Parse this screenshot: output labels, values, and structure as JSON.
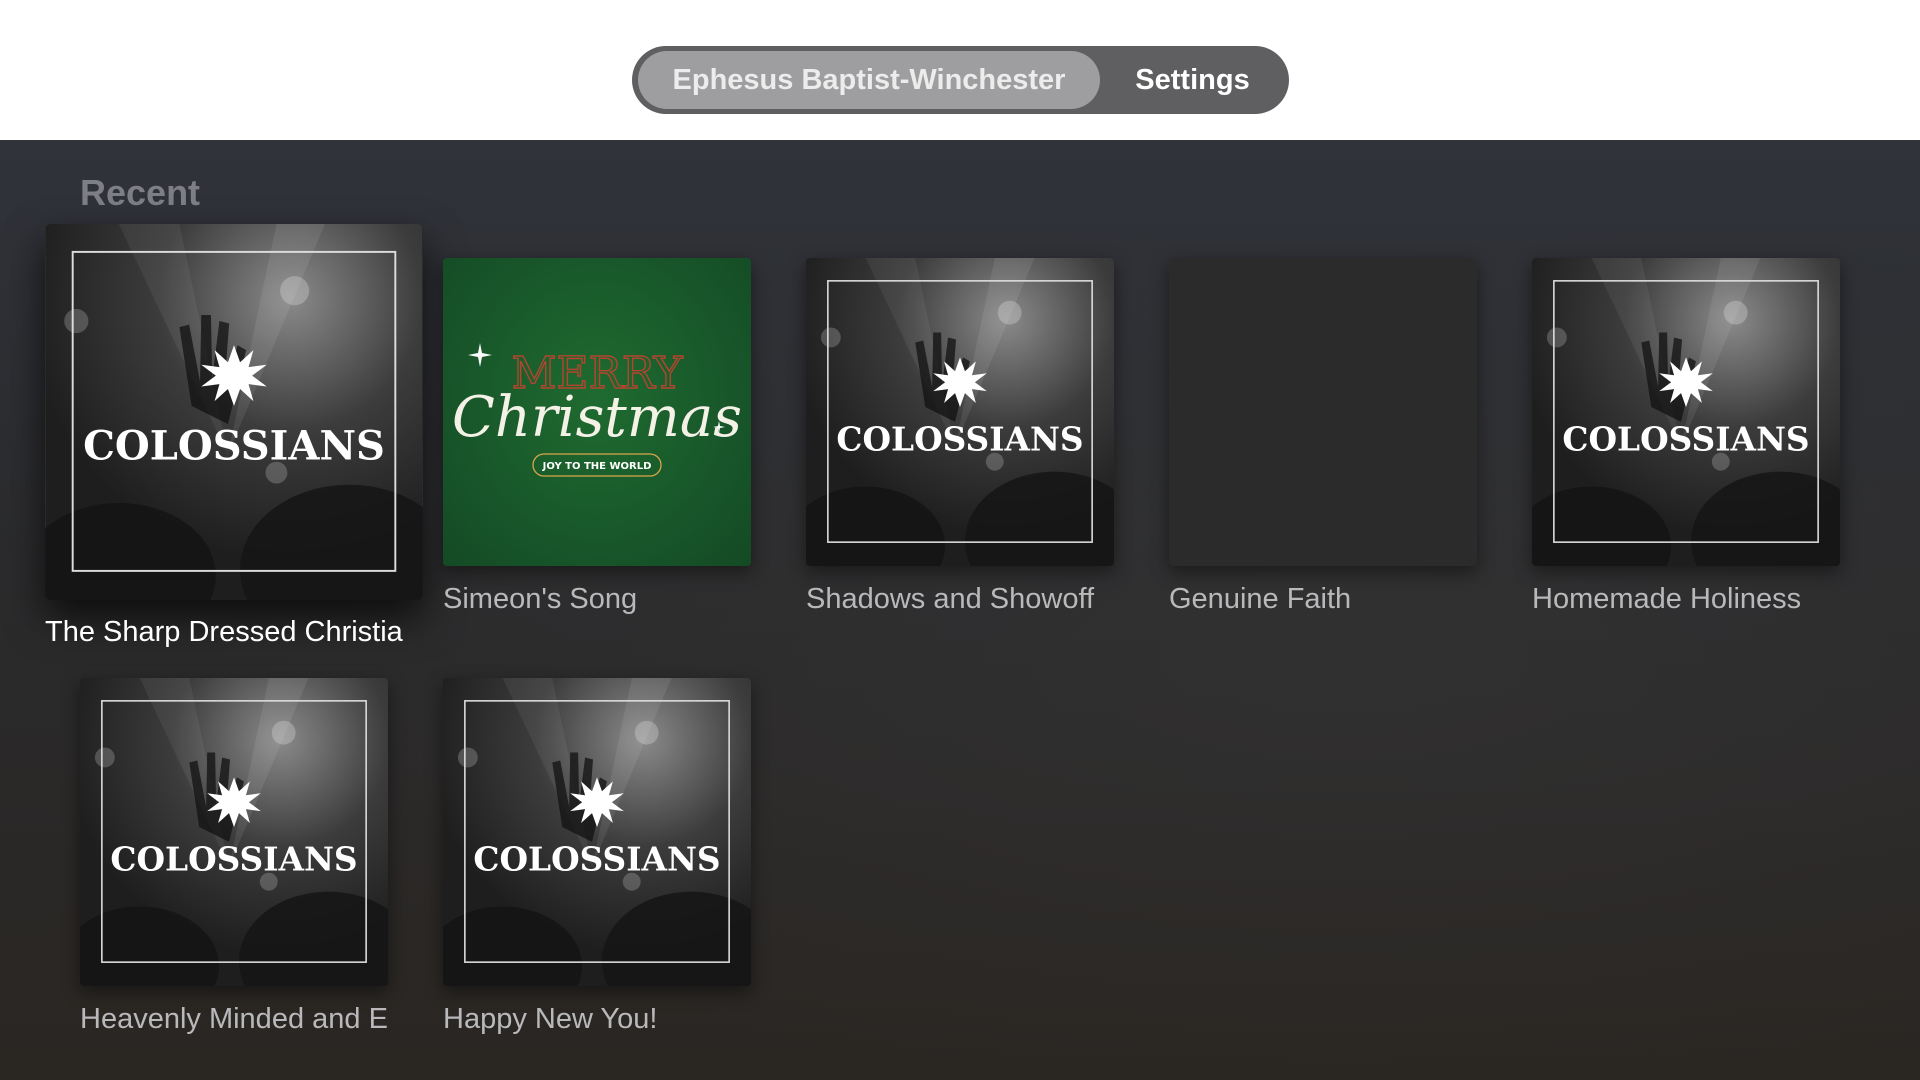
{
  "tabs": {
    "church_label": "Ephesus Baptist-Winchester",
    "settings_label": "Settings"
  },
  "section": {
    "title": "Recent"
  },
  "artwork_text": {
    "colossians": "COLOSSIANS",
    "merry": "MERRY",
    "christmas": "Christmas",
    "joy": "JOY TO THE WORLD"
  },
  "tiles": [
    {
      "label": "The Sharp Dressed Christia",
      "art": "colossians",
      "focused": true
    },
    {
      "label": "Simeon's Song",
      "art": "christmas"
    },
    {
      "label": "Shadows and Showoff",
      "art": "colossians"
    },
    {
      "label": "Genuine Faith",
      "art": "empty"
    },
    {
      "label": "Homemade Holiness",
      "art": "colossians"
    },
    {
      "label": "Heavenly Minded and E",
      "art": "colossians"
    },
    {
      "label": "Happy New You!",
      "art": "colossians"
    }
  ],
  "colors": {
    "tab_bar": "#5f5f61",
    "tab_selected": "#9e9ea0",
    "christmas_green": "#18572a",
    "christmas_red": "#b5452f"
  }
}
